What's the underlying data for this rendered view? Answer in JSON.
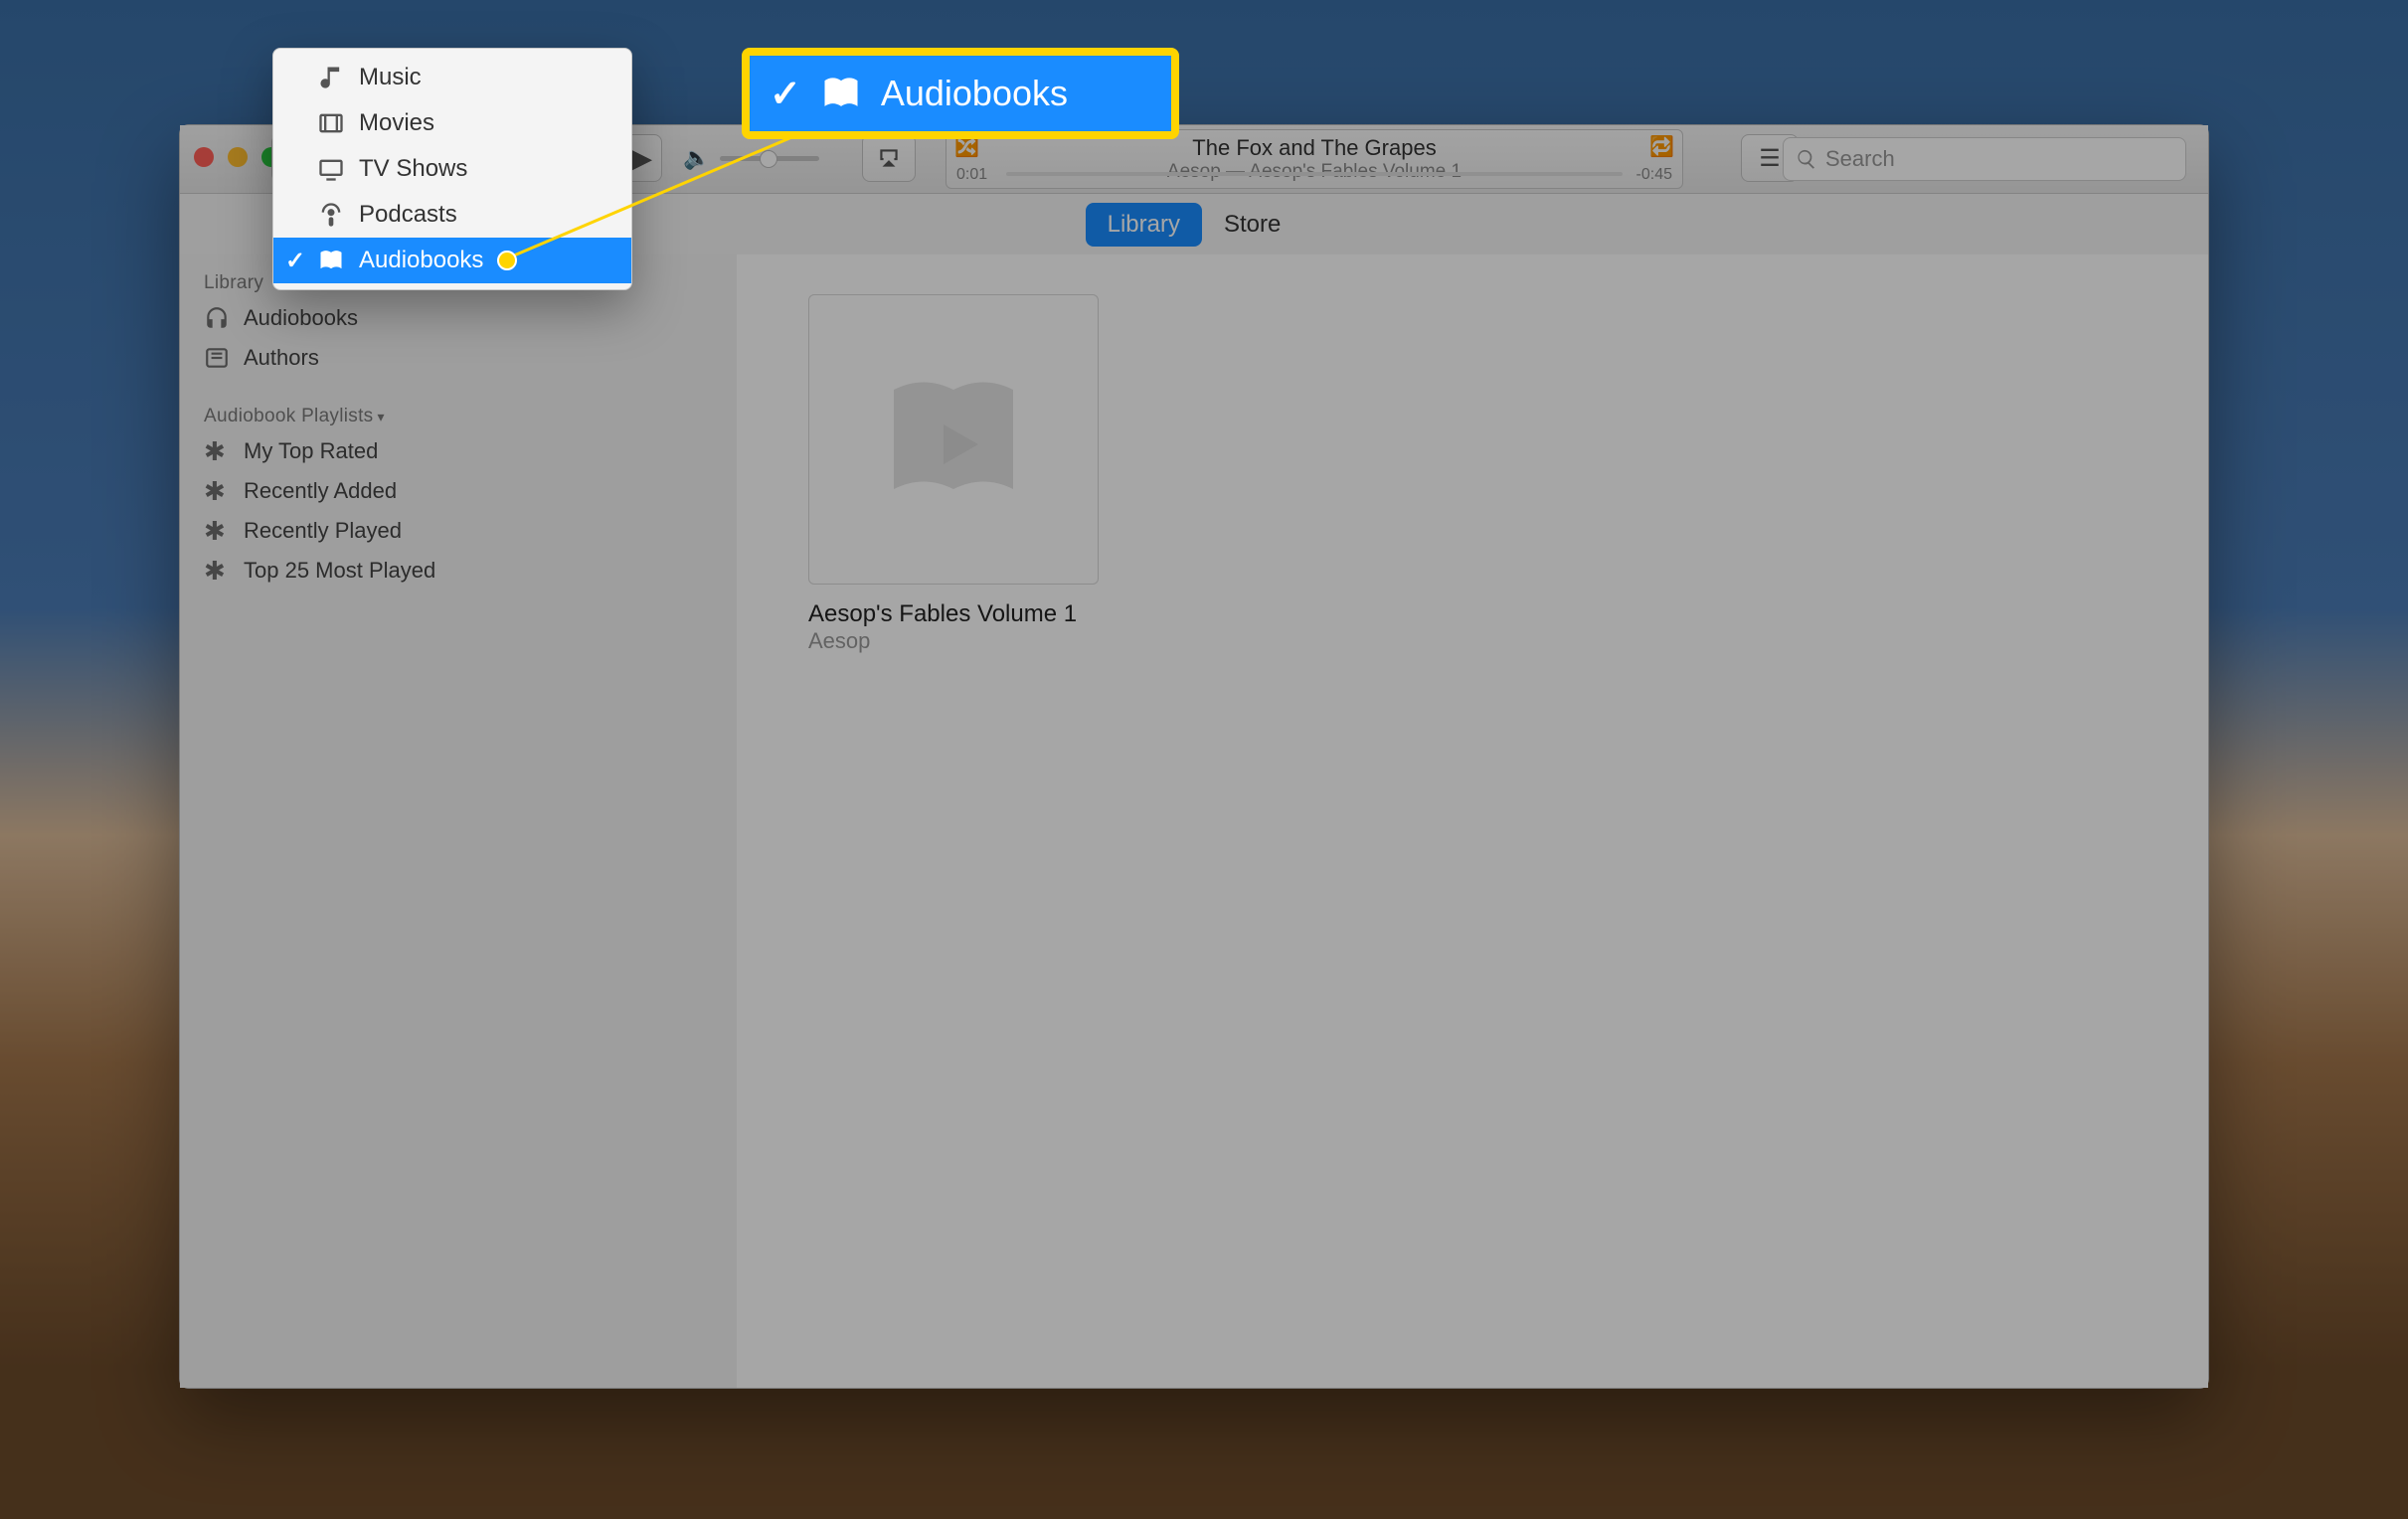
{
  "playback": {
    "title": "The Fox and The Grapes",
    "subtitle": "Aesop — Aesop's Fables Volume 1",
    "elapsed": "0:01",
    "remaining": "-0:45"
  },
  "search": {
    "placeholder": "Search"
  },
  "tabs": {
    "library": "Library",
    "store": "Store"
  },
  "sidebar": {
    "library_header": "Library",
    "audiobooks": "Audiobooks",
    "authors": "Authors",
    "playlists_header": "Audiobook Playlists",
    "pl": [
      "My Top Rated",
      "Recently Added",
      "Recently Played",
      "Top 25 Most Played"
    ]
  },
  "grid": {
    "item_title": "Aesop's Fables Volume 1",
    "item_author": "Aesop"
  },
  "menu": {
    "items": [
      "Music",
      "Movies",
      "TV Shows",
      "Podcasts",
      "Audiobooks"
    ],
    "selected": "Audiobooks"
  },
  "callout": {
    "label": "Audiobooks"
  }
}
